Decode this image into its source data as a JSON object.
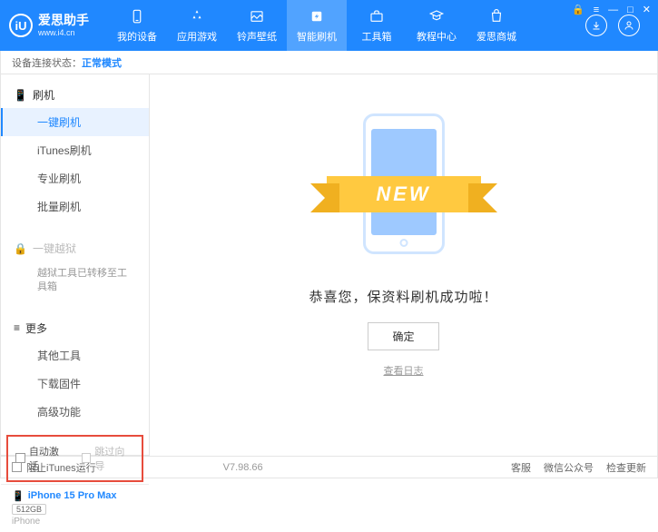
{
  "header": {
    "logo_char": "iU",
    "title": "爱思助手",
    "url": "www.i4.cn",
    "nav": [
      {
        "label": "我的设备"
      },
      {
        "label": "应用游戏"
      },
      {
        "label": "铃声壁纸"
      },
      {
        "label": "智能刷机"
      },
      {
        "label": "工具箱"
      },
      {
        "label": "教程中心"
      },
      {
        "label": "爱思商城"
      }
    ]
  },
  "status": {
    "label": "设备连接状态：",
    "mode": "正常模式"
  },
  "sidebar": {
    "flash_header": "刷机",
    "items_flash": [
      {
        "label": "一键刷机"
      },
      {
        "label": "iTunes刷机"
      },
      {
        "label": "专业刷机"
      },
      {
        "label": "批量刷机"
      }
    ],
    "jailbreak_header": "一键越狱",
    "jailbreak_note": "越狱工具已转移至工具箱",
    "more_header": "更多",
    "items_more": [
      {
        "label": "其他工具"
      },
      {
        "label": "下载固件"
      },
      {
        "label": "高级功能"
      }
    ],
    "checkboxes": {
      "auto_activate": "自动激活",
      "skip_guide": "跳过向导"
    },
    "device": {
      "name": "iPhone 15 Pro Max",
      "storage": "512GB",
      "type": "iPhone"
    }
  },
  "content": {
    "ribbon": "NEW",
    "success": "恭喜您，保资料刷机成功啦！",
    "ok": "确定",
    "view_log": "查看日志"
  },
  "footer": {
    "block_itunes": "阻止iTunes运行",
    "version": "V7.98.66",
    "links": [
      "客服",
      "微信公众号",
      "检查更新"
    ]
  }
}
